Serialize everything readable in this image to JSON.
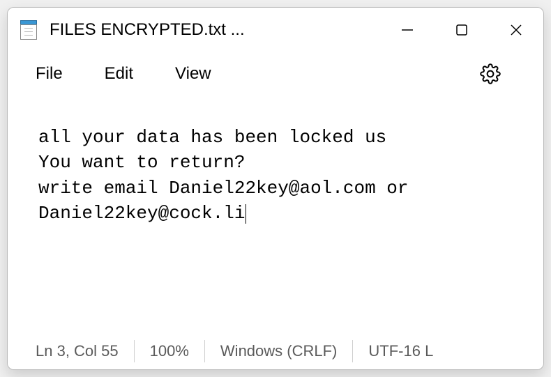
{
  "titlebar": {
    "title": "FILES ENCRYPTED.txt ..."
  },
  "menubar": {
    "file": "File",
    "edit": "Edit",
    "view": "View"
  },
  "editor": {
    "line1": "all your data has been locked us",
    "line2": "You want to return?",
    "line3": "write email Daniel22key@aol.com or ",
    "line4": "Daniel22key@cock.li"
  },
  "statusbar": {
    "position": "Ln 3, Col 55",
    "zoom": "100%",
    "eol": "Windows (CRLF)",
    "encoding": "UTF-16 L"
  }
}
